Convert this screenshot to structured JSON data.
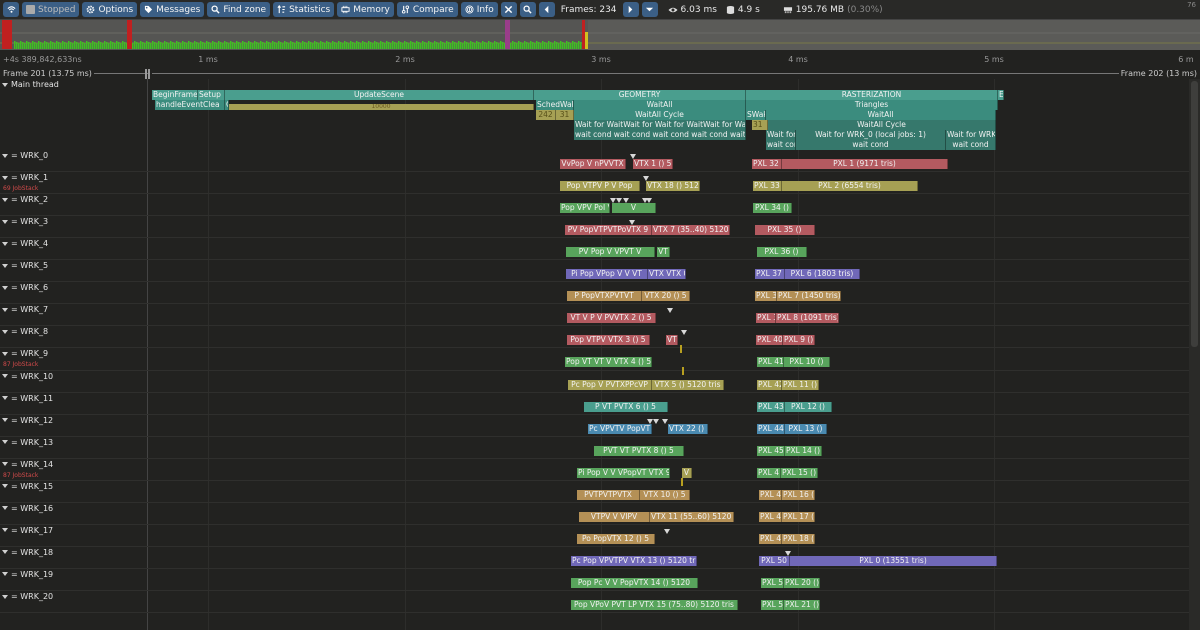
{
  "toolbar": {
    "connection_icon": "wifi-icon",
    "stopped_label": "Stopped",
    "options_label": "Options",
    "messages_label": "Messages",
    "find_zone_label": "Find zone",
    "statistics_label": "Statistics",
    "memory_label": "Memory",
    "compare_label": "Compare",
    "info_label": "Info",
    "frames_label": "Frames: 234",
    "frame_time": "6.03 ms",
    "zone_time": "4.9 s",
    "memory_usage": "195.76 MB",
    "memory_percent": "(0.30%)",
    "fps_corner": "76"
  },
  "frames_strip": {
    "bars_green": "#3fbf23",
    "bar_yellow": "#d0c020",
    "bar_red": "#c02020",
    "bar_purple": "#9a3d8a",
    "selection_color": "#5b5b58"
  },
  "ruler": {
    "offset": "+4s 389,842,633ns",
    "ticks": [
      "1 ms",
      "2 ms",
      "3 ms",
      "4 ms",
      "5 ms",
      "6 m"
    ]
  },
  "frame_bar": {
    "left": "Frame 201 (13.75 ms)",
    "right": "Frame 202 (13 ms)"
  },
  "main_thread": {
    "label": "Main thread",
    "zones": [
      {
        "text": "BeginFrame",
        "color": "teal"
      },
      {
        "text": "Setup",
        "color": "teal"
      },
      {
        "text": "UpdateScene",
        "color": "teal"
      },
      {
        "text": "GEOMETRY",
        "color": "teal"
      },
      {
        "text": "RASTERIZATION",
        "color": "teal"
      },
      {
        "text": "E",
        "color": "teal"
      },
      {
        "text": "handleEventClea",
        "color": "teal"
      },
      {
        "text": "Cle",
        "color": "teal"
      },
      {
        "text": "10000",
        "color": "olive"
      },
      {
        "text": "SchedWake",
        "color": "teal"
      },
      {
        "text": "WaitAll",
        "color": "teal"
      },
      {
        "text": "Triangles",
        "color": "teal"
      },
      {
        "text": "242",
        "color": "olive"
      },
      {
        "text": "31",
        "color": "olive"
      },
      {
        "text": "WaitAll Cycle",
        "color": "teal"
      },
      {
        "text": "SWake",
        "color": "teal"
      },
      {
        "text": "WaitAll",
        "color": "teal"
      },
      {
        "text": "Wait for WaitWait for Wait for WaitWait for WaitWait for",
        "color": "teal"
      },
      {
        "text": "31",
        "color": "olive"
      },
      {
        "text": "WaitAll Cycle",
        "color": "teal"
      },
      {
        "text": "wait cond wait cond wait cond wait cond wait cond wait cond",
        "color": "teal"
      },
      {
        "text": "Wait for",
        "color": "teal"
      },
      {
        "text": "Wait for WRK_0 (local jobs: 1)",
        "color": "teal"
      },
      {
        "text": "Wait for WRK_",
        "color": "teal"
      },
      {
        "text": "wait cor",
        "color": "teal"
      },
      {
        "text": "wait cond",
        "color": "teal"
      },
      {
        "text": "wait cond",
        "color": "teal"
      }
    ]
  },
  "workers": [
    {
      "label": "= WRK_0",
      "note": "",
      "geo": "VvPop V nPVVTX",
      "geo2": "VTX 1 () 5",
      "raster": "PXL 32 (",
      "raster2": "PXL 1 (9171 tris)"
    },
    {
      "label": "= WRK_1",
      "note": "69 JobStack",
      "geo": "Pop VTPV P V Pop",
      "geo2": "VTX 18 () 5120",
      "raster": "PXL 33 (",
      "raster2": "PXL 2 (6554 tris)"
    },
    {
      "label": "= WRK_2",
      "note": "",
      "geo": "Pop VPV PoI VTV",
      "geo2": "V",
      "raster": "PXL 34 ()",
      "raster2": ""
    },
    {
      "label": "= WRK_3",
      "note": "",
      "geo": "PV PopVTPVTPoVTX 9",
      "geo2": "VTX 7 (35..40) 5120 tris",
      "raster": "PXL 35 ()",
      "raster2": ""
    },
    {
      "label": "= WRK_4",
      "note": "",
      "geo": "PV Pop V VPVT V",
      "geo2": "VT",
      "raster": "PXL 36 ()",
      "raster2": ""
    },
    {
      "label": "= WRK_5",
      "note": "",
      "geo": "Pi Pop VPop V V VT",
      "geo2": "VTX VTX 0 () 5",
      "raster": "PXL 37 ()",
      "raster2": "PXL 6 (1803 tris)"
    },
    {
      "label": "= WRK_6",
      "note": "",
      "geo": "P PopVTXPVTVT",
      "geo2": "VTX 20 () 5",
      "raster": "PXL 38",
      "raster2": "PXL 7 (1450 tris)"
    },
    {
      "label": "= WRK_7",
      "note": "",
      "geo": "VT V P V PVVTX 2 () 5",
      "geo2": "",
      "raster": "PXL 39",
      "raster2": "PXL 8 (1091 tris)"
    },
    {
      "label": "= WRK_8",
      "note": "",
      "geo": "Pop VTPV VTX 3 () 5",
      "geo2": "VT",
      "raster": "PXL 40",
      "raster2": "PXL 9 ()"
    },
    {
      "label": "= WRK_9",
      "note": "87 JobStack",
      "geo": "Pop VT VT V VTX 4 () 5",
      "geo2": "",
      "raster": "PXL 41",
      "raster2": "PXL 10 ()"
    },
    {
      "label": "= WRK_10",
      "note": "",
      "geo": "Pc Pop V PVTXPPcVP",
      "geo2": "VTX 5 () 5120 tris",
      "raster": "PXL 42",
      "raster2": "PXL 11 ()"
    },
    {
      "label": "= WRK_11",
      "note": "",
      "geo": "P VT PVTX 6 () 5",
      "geo2": "",
      "raster": "PXL 43",
      "raster2": "PXL 12 ()"
    },
    {
      "label": "= WRK_12",
      "note": "",
      "geo": "Pc VPVTV PopVT V",
      "geo2": "VTX 22 () 5",
      "raster": "PXL 44 ()",
      "raster2": "PXL 13 ()"
    },
    {
      "label": "= WRK_13",
      "note": "",
      "geo": "PVT VT PVTX 8 () 5",
      "geo2": "",
      "raster": "PXL 45",
      "raster2": "PXL 14 ()"
    },
    {
      "label": "= WRK_14",
      "note": "87 JobStack",
      "geo": "Pi Pop V V VPopVT VTX 9 ()",
      "geo2": "V",
      "raster": "PXL 4",
      "raster2": "PXL 15 ()"
    },
    {
      "label": "= WRK_15",
      "note": "",
      "geo": "PVTPVTPVTX",
      "geo2": "VTX 10 () 5",
      "raster": "PXL 4",
      "raster2": "PXL 16 ()"
    },
    {
      "label": "= WRK_16",
      "note": "",
      "geo": "VTPV V VIPV",
      "geo2": "VTX 11 (55..60) 5120 tris",
      "raster": "PXL 4",
      "raster2": "PXL 17 ()"
    },
    {
      "label": "= WRK_17",
      "note": "",
      "geo": "Po PopVTX 12 () 5",
      "geo2": "",
      "raster": "PXL 4",
      "raster2": "PXL 18 ()"
    },
    {
      "label": "= WRK_18",
      "note": "",
      "geo": "Pc Pop VPVTPV VTX 13 () 5120 tr",
      "geo2": "",
      "raster": "PXL 50",
      "raster2": "PXL 0 (13551 tris)"
    },
    {
      "label": "= WRK_19",
      "note": "",
      "geo": "Pop Pc V V PopVTX 14 () 5120",
      "geo2": "",
      "raster": "PXL 51",
      "raster2": "PXL 20 ()"
    },
    {
      "label": "= WRK_20",
      "note": "",
      "geo": "Pop VPoV PVT LP VTX 15 (75..80) 5120 tris",
      "geo2": "",
      "raster": "PXL 5",
      "raster2": "PXL 21 ()"
    }
  ]
}
